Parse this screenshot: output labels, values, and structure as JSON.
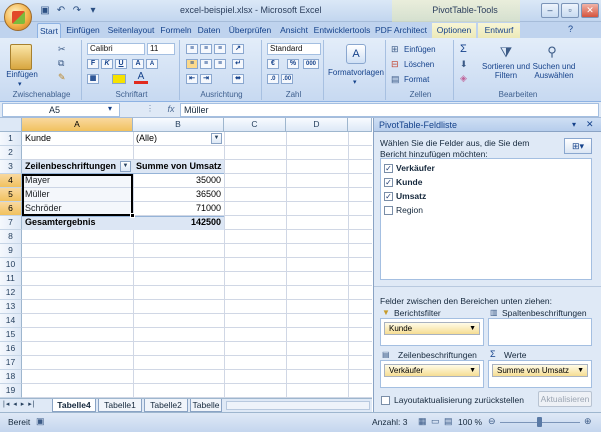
{
  "titlebar": {
    "document_title": "excel-beispiel.xlsx - Microsoft Excel",
    "context_title": "PivotTable-Tools",
    "qat_icons": [
      "save-icon",
      "undo-icon",
      "redo-icon",
      "customize-qat-icon"
    ]
  },
  "ribbon_tabs": [
    "Start",
    "Einfügen",
    "Seitenlayout",
    "Formeln",
    "Daten",
    "Überprüfen",
    "Ansicht",
    "Entwicklertools",
    "PDF Architect",
    "Optionen",
    "Entwurf"
  ],
  "ribbon": {
    "clipboard": {
      "paste": "Einfügen",
      "label": "Zwischenablage"
    },
    "font": {
      "name": "Calibri",
      "size": "11",
      "bold": "F",
      "italic": "K",
      "underline": "U",
      "label": "Schriftart"
    },
    "alignment": {
      "label": "Ausrichtung"
    },
    "number": {
      "format": "Standard",
      "label": "Zahl",
      "percent": "%",
      "thousands": "000"
    },
    "styles": {
      "button": "Formatvorlagen"
    },
    "cells": {
      "insert": "Einfügen",
      "delete": "Löschen",
      "format": "Format",
      "label": "Zellen"
    },
    "editing": {
      "sort": "Sortieren und Filtern",
      "find": "Suchen und Auswählen",
      "label": "Bearbeiten",
      "sigma": "Σ"
    }
  },
  "formula_bar": {
    "name_box": "A5",
    "fx": "fx",
    "content": "Müller"
  },
  "grid": {
    "columns": [
      "A",
      "B",
      "C",
      "D"
    ],
    "rows": [
      "1",
      "2",
      "3",
      "4",
      "5",
      "6",
      "7",
      "8",
      "9",
      "10",
      "11",
      "12",
      "13",
      "14",
      "15",
      "16",
      "17",
      "18",
      "19"
    ],
    "cells": {
      "a1": "Kunde",
      "b1": "(Alle)",
      "a3": "Zeilenbeschriftungen",
      "b3": "Summe von Umsatz",
      "a4": "Mayer",
      "b4": "35000",
      "a5": "Müller",
      "b5": "36500",
      "a6": "Schröder",
      "b6": "71000",
      "a7": "Gesamtergebnis",
      "b7": "142500"
    }
  },
  "sheet_tabs": [
    "Tabelle4",
    "Tabelle1",
    "Tabelle2",
    "Tabelle"
  ],
  "pivot_pane": {
    "title": "PivotTable-Feldliste",
    "instruction": "Wählen Sie die Felder aus, die Sie dem Bericht hinzufügen möchten:",
    "fields": [
      {
        "name": "Verkäufer",
        "checked": true
      },
      {
        "name": "Kunde",
        "checked": true
      },
      {
        "name": "Umsatz",
        "checked": true
      },
      {
        "name": "Region",
        "checked": false
      }
    ],
    "areas_instruction": "Felder zwischen den Bereichen unten ziehen:",
    "report_filter_label": "Berichtsfilter",
    "column_labels_label": "Spaltenbeschriftungen",
    "row_labels_label": "Zeilenbeschriftungen",
    "values_label": "Werte",
    "report_filter_item": "Kunde",
    "row_item": "Verkäufer",
    "value_item": "Summe von Umsatz",
    "defer_label": "Layoutaktualisierung zurückstellen",
    "update_button": "Aktualisieren"
  },
  "statusbar": {
    "mode": "Bereit",
    "count": "Anzahl: 3",
    "zoom": "100 %"
  }
}
